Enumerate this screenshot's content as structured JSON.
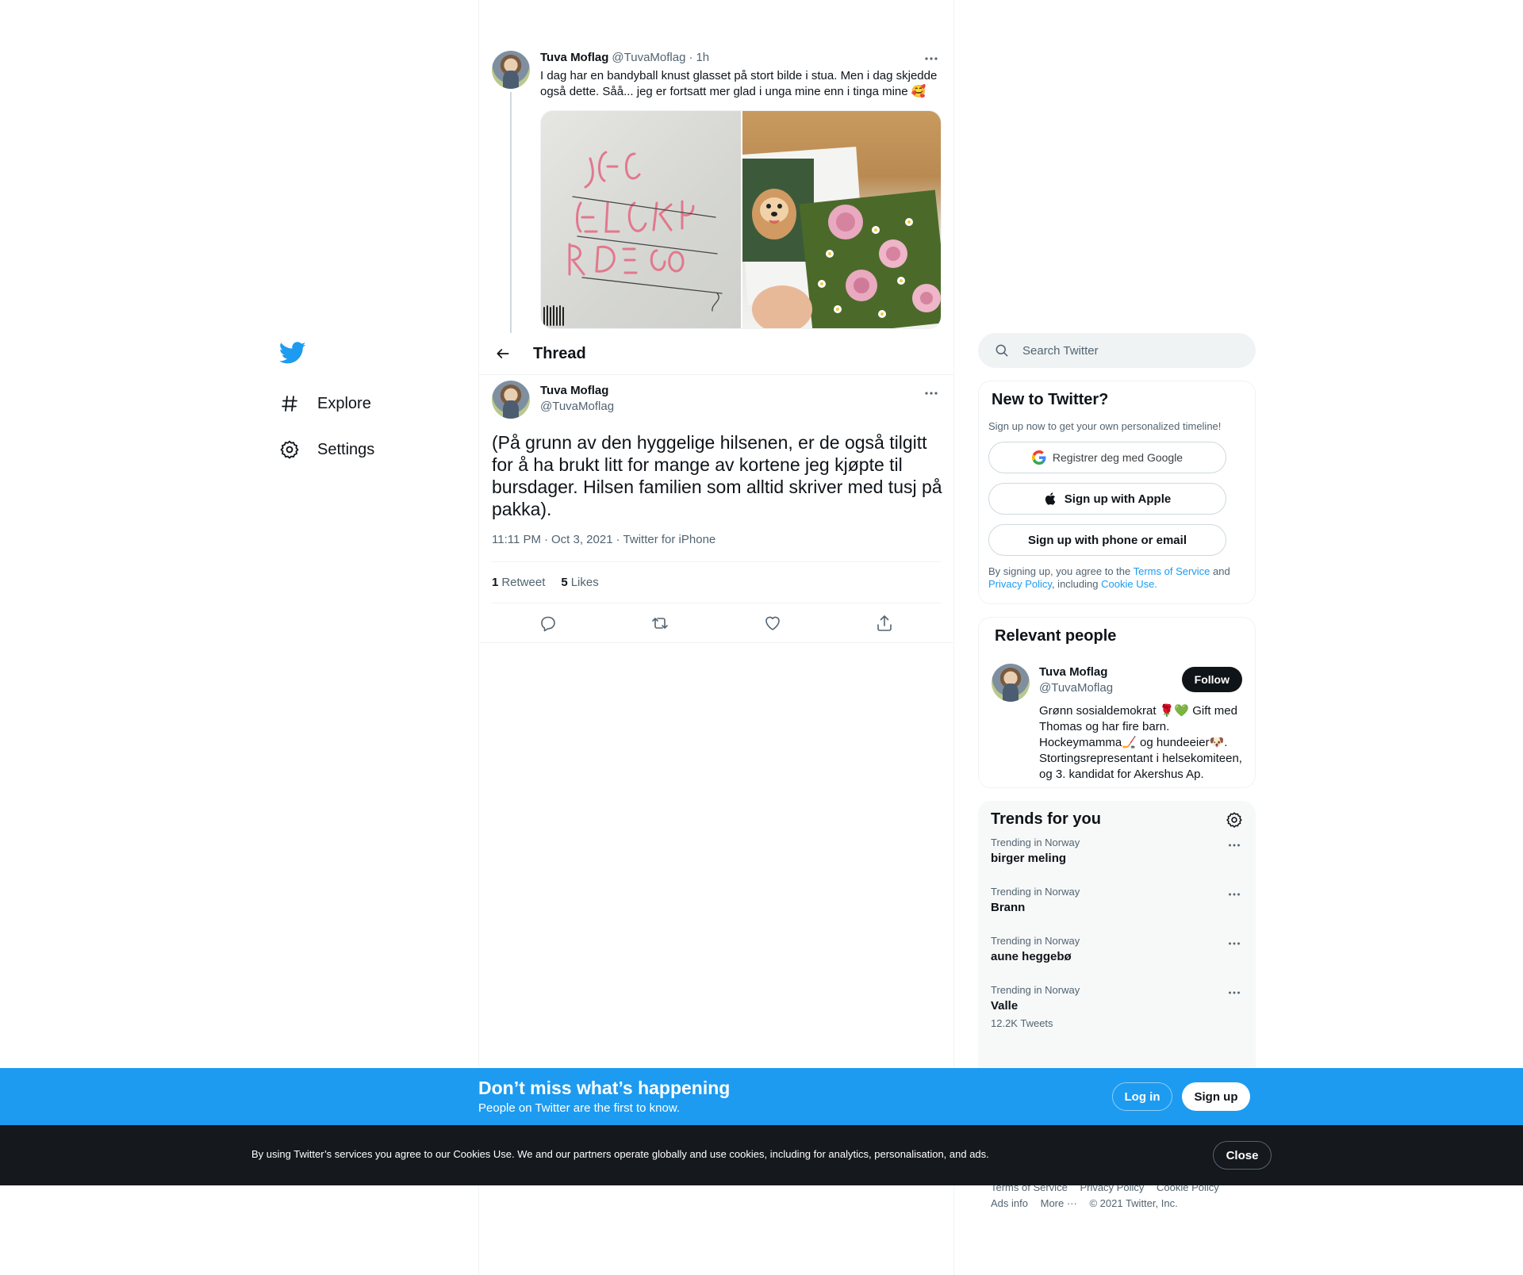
{
  "nav": {
    "logo_icon": "twitter-bird-icon",
    "items": [
      {
        "label": "Explore",
        "icon": "hashtag-icon"
      },
      {
        "label": "Settings",
        "icon": "gear-icon"
      }
    ]
  },
  "parent_tweet": {
    "name": "Tuva Moflag",
    "handle": "@TuvaMoflag",
    "separator": "·",
    "time": "1h",
    "text": "I dag har en bandyball knust glasset på stort bilde i stua. Men i dag skjedde også dette. Såå... jeg er fortsatt mer glad i unga mine enn i tinga mine 🥰"
  },
  "thread_header": {
    "title": "Thread"
  },
  "main_tweet": {
    "name": "Tuva Moflag",
    "handle": "@TuvaMoflag",
    "text": "(På grunn av den hyggelige hilsenen, er de også tilgitt for å ha brukt litt for mange av kortene jeg kjøpte til bursdager. Hilsen familien som alltid skriver med tusj på pakka).",
    "time": "11:11 PM",
    "separator": "·",
    "date": "Oct 3, 2021",
    "source": "Twitter for iPhone",
    "retweet_count": "1",
    "retweet_label": "Retweet",
    "like_count": "5",
    "like_label": "Likes"
  },
  "sidebar": {
    "search_placeholder": "Search Twitter",
    "new_to_twitter": {
      "title": "New to Twitter?",
      "subtitle": "Sign up now to get your own personalized timeline!",
      "google_label": "Registrer deg med Google",
      "apple_label": "Sign up with Apple",
      "phone_label": "Sign up with phone or email",
      "legal_prefix": "By signing up, you agree to the ",
      "terms_link": "Terms of Service",
      "legal_and": " and ",
      "privacy_link": "Privacy Policy",
      "legal_including": ", including ",
      "cookie_link": "Cookie Use."
    },
    "relevant_people": {
      "title": "Relevant people",
      "name": "Tuva Moflag",
      "handle": "@TuvaMoflag",
      "follow_label": "Follow",
      "bio": "Grønn sosialdemokrat 🌹💚 Gift med Thomas og har fire barn. Hockeymamma🏒 og hundeeier🐶. Stortingsrepresentant i helsekomiteen, og 3. kandidat for Akershus Ap."
    },
    "trends": {
      "title": "Trends for you",
      "items": [
        {
          "category": "Trending in Norway",
          "name": "birger meling",
          "count": ""
        },
        {
          "category": "Trending in Norway",
          "name": "Brann",
          "count": ""
        },
        {
          "category": "Trending in Norway",
          "name": "aune heggebø",
          "count": ""
        },
        {
          "category": "Trending in Norway",
          "name": "Valle",
          "count": "12.2K Tweets"
        }
      ]
    },
    "footer": {
      "terms": "Terms of Service",
      "privacy": "Privacy Policy",
      "cookie": "Cookie Policy",
      "ads": "Ads info",
      "more": "More ···",
      "copyright": "© 2021 Twitter, Inc."
    }
  },
  "bottom_bar": {
    "title": "Don’t miss what’s happening",
    "subtitle": "People on Twitter are the first to know.",
    "login_label": "Log in",
    "signup_label": "Sign up"
  },
  "cookie_bar": {
    "text": "By using Twitter’s services you agree to our Cookies Use. We and our partners operate globally and use cookies, including for analytics, personalisation, and ads.",
    "close_label": "Close"
  },
  "colors": {
    "brand_blue": "#1d9bf0",
    "text_primary": "#0f1419",
    "text_secondary": "#536471",
    "cookie_bar_bg": "#15181c"
  }
}
